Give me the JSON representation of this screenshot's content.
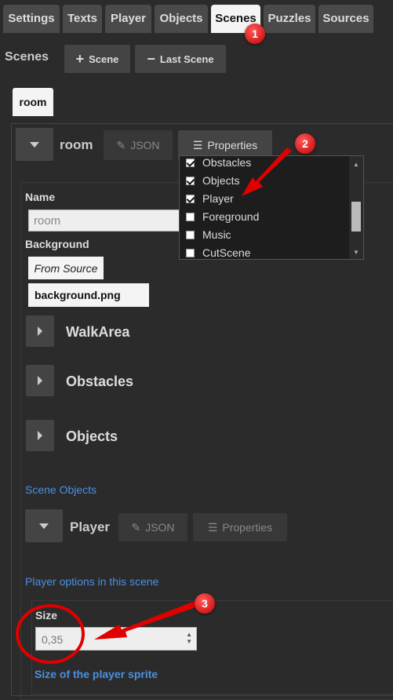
{
  "tabs": [
    {
      "label": "Settings",
      "active": false
    },
    {
      "label": "Texts",
      "active": false
    },
    {
      "label": "Player",
      "active": false
    },
    {
      "label": "Objects",
      "active": false
    },
    {
      "label": "Scenes",
      "active": true
    },
    {
      "label": "Puzzles",
      "active": false
    },
    {
      "label": "Sources",
      "active": false
    }
  ],
  "scenes_heading": "Scenes",
  "add_scene_label": "Scene",
  "last_scene_label": "Last Scene",
  "scene_tab_label": "room",
  "scene": {
    "title": "room",
    "json_label": "JSON",
    "properties_label": "Properties",
    "name_label": "Name",
    "name_value": "room",
    "background_label": "Background",
    "from_source_label": "From Source",
    "background_value": "background.png",
    "sections": [
      "WalkArea",
      "Obstacles",
      "Objects"
    ]
  },
  "properties_dropdown": {
    "items": [
      {
        "label": "Obstacles",
        "checked": true
      },
      {
        "label": "Objects",
        "checked": true
      },
      {
        "label": "Player",
        "checked": true
      },
      {
        "label": "Foreground",
        "checked": false
      },
      {
        "label": "Music",
        "checked": false
      },
      {
        "label": "CutScene",
        "checked": false
      }
    ]
  },
  "scene_objects_link": "Scene Objects",
  "player": {
    "title": "Player",
    "json_label": "JSON",
    "properties_label": "Properties",
    "options_link": "Player options in this scene",
    "size_label": "Size",
    "size_value": "0,35",
    "size_help": "Size of the player sprite"
  },
  "annotations": [
    "1",
    "2",
    "3"
  ],
  "colors": {
    "accent_link": "#4a90e2",
    "annotation_red": "#e00000"
  }
}
